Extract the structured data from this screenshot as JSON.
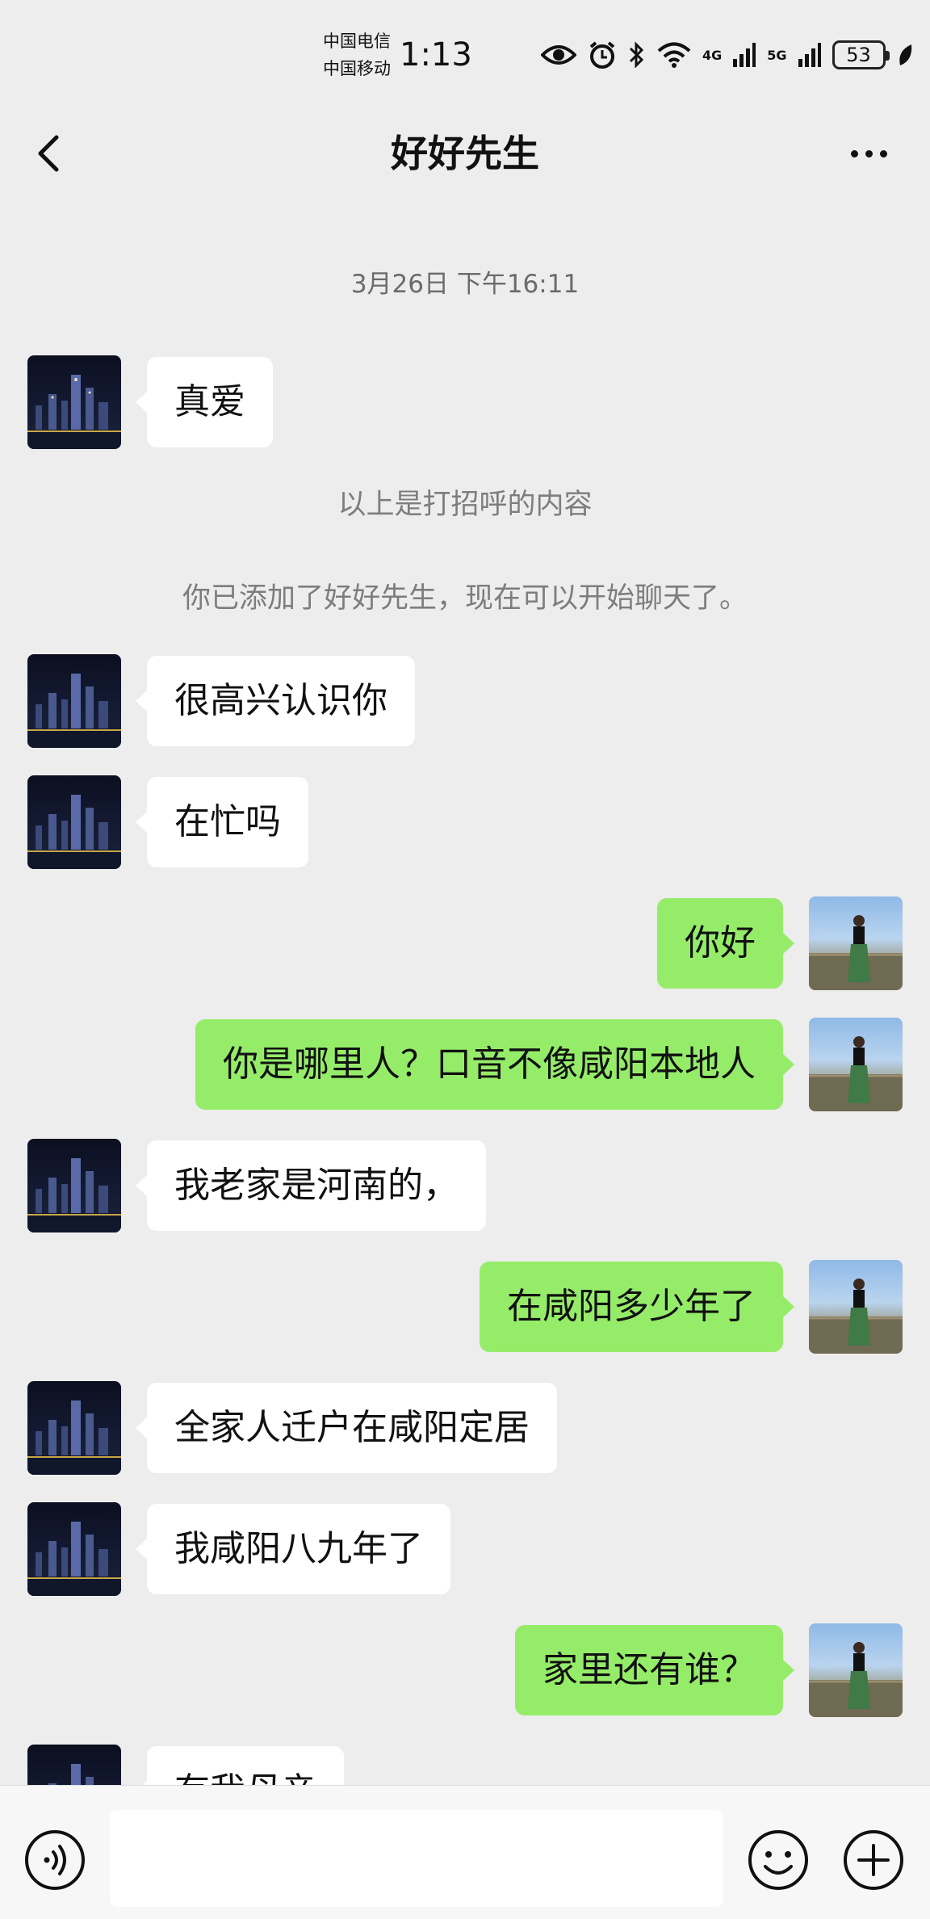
{
  "status_bar": {
    "carrier_1": "中国电信",
    "carrier_2": "中国移动",
    "time": "1:13",
    "network_1": "4G",
    "network_2": "5G",
    "battery": "53"
  },
  "header": {
    "title": "好好先生"
  },
  "chat": {
    "timestamp": "3月26日 下午16:11",
    "system_1": "以上是打招呼的内容",
    "system_2": "你已添加了好好先生，现在可以开始聊天了。",
    "messages": [
      {
        "side": "left",
        "text": "真爱"
      },
      {
        "side": "left",
        "text": "很高兴认识你"
      },
      {
        "side": "left",
        "text": "在忙吗"
      },
      {
        "side": "right",
        "text": "你好"
      },
      {
        "side": "right",
        "text": "你是哪里人？口音不像咸阳本地人"
      },
      {
        "side": "left",
        "text": "我老家是河南的，"
      },
      {
        "side": "right",
        "text": "在咸阳多少年了"
      },
      {
        "side": "left",
        "text": "全家人迁户在咸阳定居"
      },
      {
        "side": "left",
        "text": "我咸阳八九年了"
      },
      {
        "side": "right",
        "text": "家里还有谁？"
      },
      {
        "side": "left",
        "text": "有我母亲"
      }
    ]
  },
  "input_bar": {
    "placeholder": ""
  },
  "colors": {
    "background": "#ededed",
    "sent_bubble": "#95ec69",
    "received_bubble": "#ffffff"
  }
}
